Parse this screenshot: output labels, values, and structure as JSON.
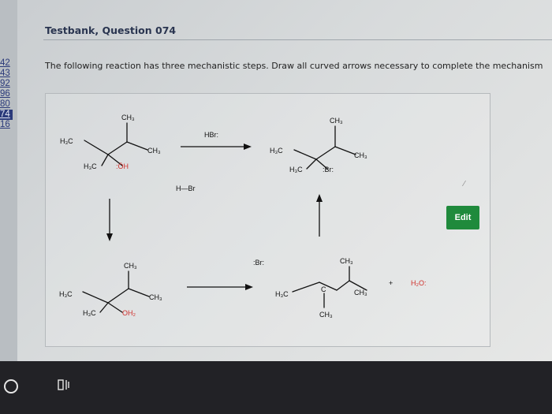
{
  "app": {
    "title": "Testbank, Question 074"
  },
  "question": {
    "text": "The following reaction has three mechanistic steps. Draw all curved arrows necessary to complete the mechanism"
  },
  "sidebar": {
    "links": [
      "42",
      "43",
      "92",
      "96",
      "80",
      "74",
      "16"
    ],
    "selected_index": 5
  },
  "actions": {
    "edit_label": "Edit"
  },
  "reaction": {
    "reactant": {
      "top": "CH₃",
      "left": "H₃C",
      "right": "CH₃",
      "bottom_left": "H₃C",
      "bottom_right": ":ÖH"
    },
    "reagent": "HBr:",
    "product": {
      "top": "CH₃",
      "left": "H₃C",
      "right": "CH₃",
      "bottom_left": "H₃C",
      "bottom_right": ":Br:"
    },
    "hbr_below": "H—Br",
    "intermediate1": {
      "top": "CH₃",
      "left": "H₃C",
      "right": "CH₃",
      "bottom_left": "H₃C",
      "bottom_right": "OH₂"
    },
    "bromide": ":Br:",
    "intermediate2": {
      "top": "CH₃",
      "left": "H₃C",
      "right": "CH₃",
      "bottom": "CH₃",
      "center": "C"
    },
    "plus": "+",
    "water": "H₂O:"
  },
  "colors": {
    "edit_button": "#1f8a3c",
    "oxygen": "#d0302c",
    "link": "#2b3a7a"
  },
  "taskbar": {
    "icons": [
      "start-circle-icon",
      "task-view-icon"
    ]
  }
}
